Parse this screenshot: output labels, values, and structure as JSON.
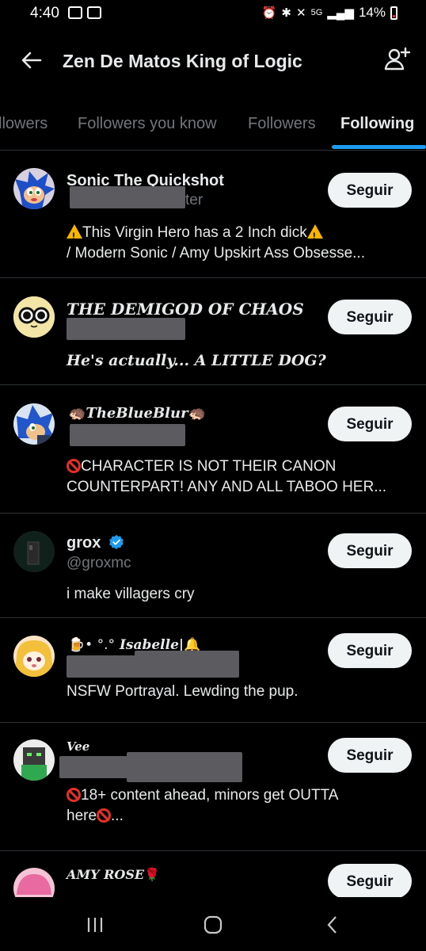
{
  "status": {
    "time": "4:40",
    "network": "5G",
    "battery": "14%"
  },
  "header": {
    "title": "Zen De Matos King of Logic"
  },
  "tabs": [
    "llowers",
    "Followers you know",
    "Followers",
    "Following"
  ],
  "accounts": [
    {
      "name": "Sonic The Quickshot",
      "handle_fragment": "ter",
      "bio_line1": "This Virgin Hero has a 2 Inch dick",
      "bio_line2": "/ Modern Sonic / Amy Upskirt Ass Obsesse...",
      "button": "Seguir"
    },
    {
      "name": "THE DEMIGOD OF CHAOS",
      "bio": "He's actually... A LITTLE DOG?",
      "button": "Seguir"
    },
    {
      "name": "TheBlueBlur",
      "bio_line1": "CHARACTER IS NOT THEIR CANON",
      "bio_line2": "COUNTERPART! ANY AND ALL TABOO HER...",
      "button": "Seguir"
    },
    {
      "name": "grox",
      "handle": "@groxmc",
      "bio": "i make villagers cry",
      "button": "Seguir"
    },
    {
      "name_prefix": "• °.°",
      "name": "Isabelle",
      "bio": "NSFW Portrayal. Lewding the pup.",
      "button": "Seguir"
    },
    {
      "name": "Vee",
      "bio_line1": "18+ content ahead, minors get OUTTA",
      "bio_line2_prefix": "here",
      "bio_line2_suffix": "...",
      "button": "Seguir"
    },
    {
      "name": "AMY ROSE",
      "button": "Seguir"
    }
  ],
  "colors": {
    "background": "#000000",
    "accent": "#1d9bf0",
    "muted": "#71767b",
    "divider": "#2f3336",
    "button_bg": "#eff3f4"
  }
}
